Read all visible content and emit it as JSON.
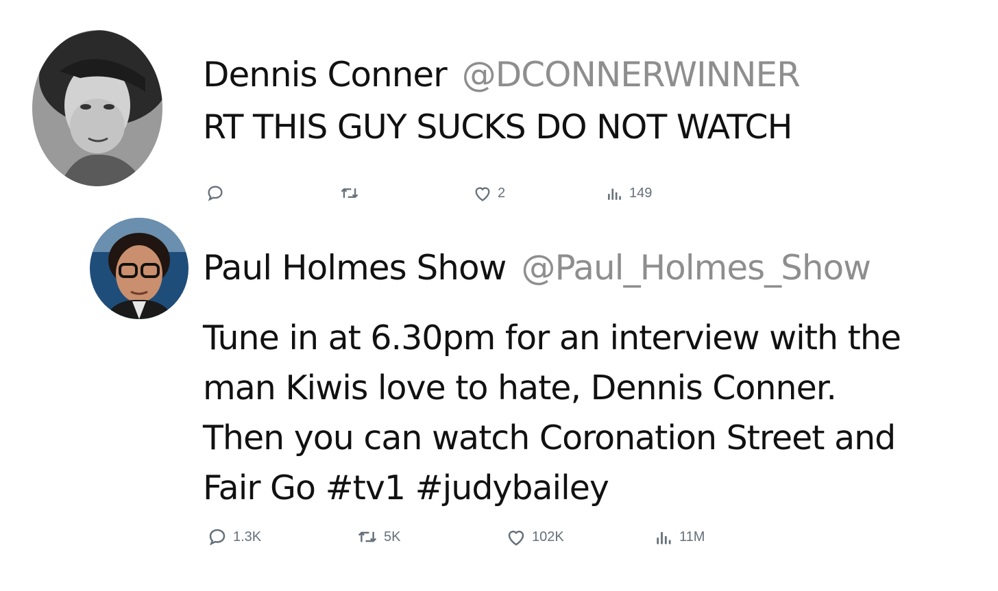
{
  "tweets": [
    {
      "display_name": "Dennis Conner",
      "handle": "@DCONNERWINNER",
      "text": "RT THIS GUY SUCKS DO NOT WATCH",
      "stats": {
        "replies": "",
        "retweets": "",
        "likes": "2",
        "views": "149"
      }
    },
    {
      "display_name": "Paul Holmes Show",
      "handle": "@Paul_Holmes_Show",
      "text_lines": [
        "Tune in at 6.30pm for an interview with the",
        "man Kiwis love to hate, Dennis Conner.",
        "Then you can watch Coronation Street and",
        "Fair Go #tv1 #judybailey"
      ],
      "stats": {
        "replies": "1.3K",
        "retweets": "5K",
        "likes": "102K",
        "views": "11M"
      }
    }
  ],
  "icons": {
    "reply": "reply-icon",
    "retweet": "retweet-icon",
    "like": "heart-icon",
    "views": "views-icon"
  },
  "colors": {
    "name": "#111111",
    "handle": "#8e8e8e",
    "action": "#65707a"
  }
}
